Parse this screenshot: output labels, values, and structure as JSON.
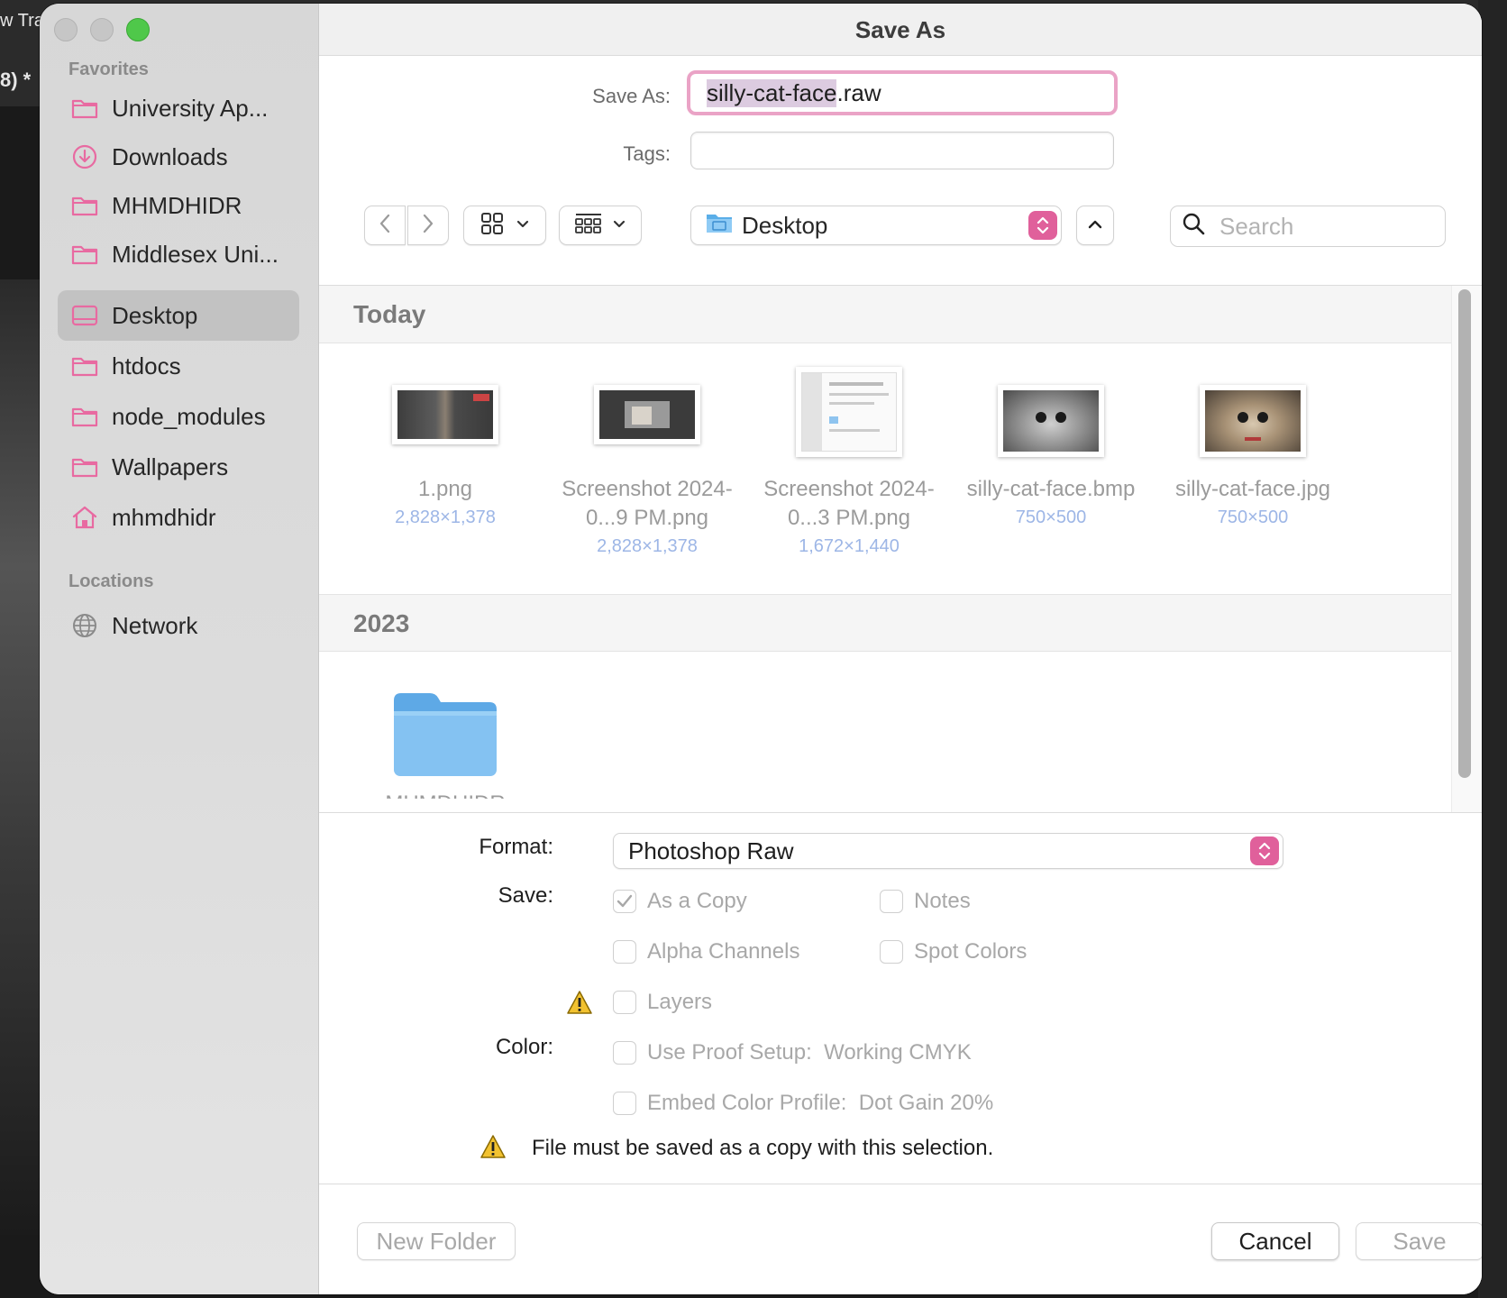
{
  "background_app": {
    "title_fragment": "w Tra",
    "doc_fragment": "8) *"
  },
  "dialog": {
    "title": "Save As"
  },
  "sidebar": {
    "favorites_heading": "Favorites",
    "favorites": [
      {
        "label": "University Ap...",
        "icon": "folder-icon"
      },
      {
        "label": "Downloads",
        "icon": "download-icon"
      },
      {
        "label": "MHMDHIDR",
        "icon": "folder-icon"
      },
      {
        "label": "Middlesex Uni...",
        "icon": "folder-icon"
      },
      {
        "label": "Desktop",
        "icon": "desktop-icon",
        "selected": true
      },
      {
        "label": "htdocs",
        "icon": "folder-icon"
      },
      {
        "label": "node_modules",
        "icon": "folder-icon"
      },
      {
        "label": "Wallpapers",
        "icon": "folder-icon"
      },
      {
        "label": "mhmdhidr",
        "icon": "home-icon"
      }
    ],
    "locations_heading": "Locations",
    "locations": [
      {
        "label": "Network",
        "icon": "globe-icon"
      }
    ]
  },
  "form": {
    "save_as_label": "Save As:",
    "filename_selected": "silly-cat-face",
    "filename_ext": ".raw",
    "tags_label": "Tags:",
    "tags_value": ""
  },
  "toolbar": {
    "location": "Desktop",
    "search_placeholder": "Search"
  },
  "sections": [
    {
      "heading": "Today",
      "files": [
        {
          "name": "1.png",
          "dims": "2,828×1,378"
        },
        {
          "name": "Screenshot 2024-0...9 PM.png",
          "dims": "2,828×1,378"
        },
        {
          "name": "Screenshot 2024-0...3 PM.png",
          "dims": "1,672×1,440"
        },
        {
          "name": "silly-cat-face.bmp",
          "dims": "750×500"
        },
        {
          "name": "silly-cat-face.jpg",
          "dims": "750×500"
        }
      ]
    },
    {
      "heading": "2023",
      "files": [
        {
          "name": "MHMDHIDR",
          "type": "folder"
        }
      ]
    }
  ],
  "options": {
    "format_label": "Format:",
    "format_value": "Photoshop Raw",
    "save_label": "Save:",
    "color_label": "Color:",
    "checkboxes": {
      "as_a_copy": {
        "label": "As a Copy",
        "checked": true
      },
      "notes": {
        "label": "Notes",
        "checked": false
      },
      "alpha_channels": {
        "label": "Alpha Channels",
        "checked": false
      },
      "spot_colors": {
        "label": "Spot Colors",
        "checked": false
      },
      "layers": {
        "label": "Layers",
        "checked": false
      },
      "use_proof_setup": {
        "label": "Use Proof Setup:  Working CMYK",
        "checked": false
      },
      "embed_color_profile": {
        "label": "Embed Color Profile:  Dot Gain 20%",
        "checked": false
      }
    },
    "warning": "File must be saved as a copy with this selection."
  },
  "footer": {
    "new_folder": "New Folder",
    "cancel": "Cancel",
    "save": "Save"
  },
  "colors": {
    "accent": "#e0609b",
    "folder_icon": "#e86aa1",
    "warning": "#f2c230"
  }
}
